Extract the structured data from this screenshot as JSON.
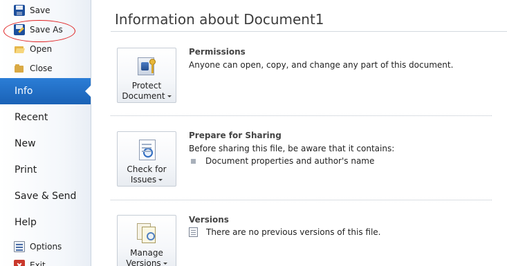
{
  "nav": {
    "commands": [
      {
        "label": "Save",
        "icon": "save-icon"
      },
      {
        "label": "Save As",
        "icon": "save-as-icon"
      },
      {
        "label": "Open",
        "icon": "open-folder-icon"
      },
      {
        "label": "Close",
        "icon": "close-folder-icon"
      }
    ],
    "tabs": [
      {
        "label": "Info",
        "active": true
      },
      {
        "label": "Recent"
      },
      {
        "label": "New"
      },
      {
        "label": "Print"
      },
      {
        "label": "Save & Send"
      },
      {
        "label": "Help"
      }
    ],
    "bottom_commands": [
      {
        "label": "Options",
        "icon": "options-icon"
      },
      {
        "label": "Exit",
        "icon": "exit-icon"
      }
    ],
    "accent_color": "#1f6ec4",
    "annotation_color": "#e02020"
  },
  "main": {
    "title": "Information about Document1",
    "sections": [
      {
        "button_line1": "Protect",
        "button_line2": "Document",
        "button_icon": "lock-key-icon",
        "heading": "Permissions",
        "description": "Anyone can open, copy, and change any part of this document."
      },
      {
        "button_line1": "Check for",
        "button_line2": "Issues",
        "button_icon": "inspect-document-icon",
        "heading": "Prepare for Sharing",
        "description": "Before sharing this file, be aware that it contains:",
        "bullets": [
          "Document properties and author's name"
        ]
      },
      {
        "button_line1": "Manage",
        "button_line2": "Versions",
        "button_icon": "versions-icon",
        "heading": "Versions",
        "note": "There are no previous versions of this file."
      }
    ]
  }
}
